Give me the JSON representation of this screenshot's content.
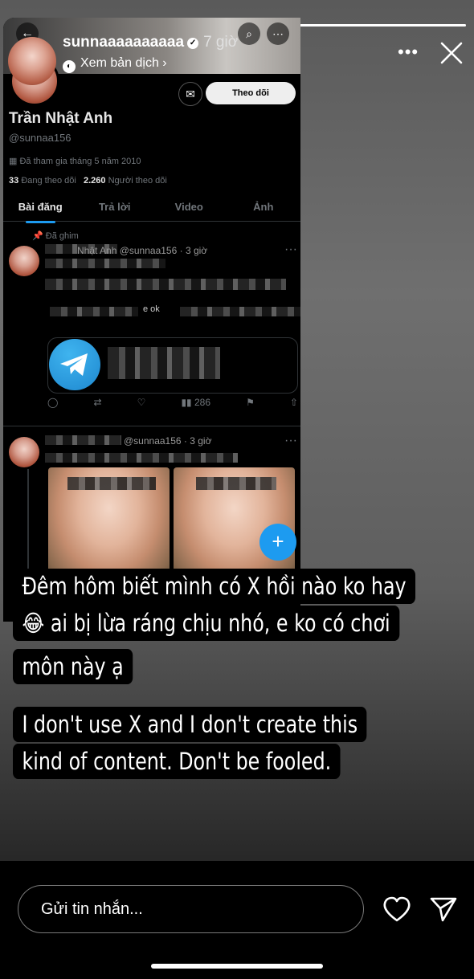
{
  "story": {
    "progress": 1.0,
    "username": "sunnaaaaaaaaaa",
    "time": "7 giờ",
    "translate_label": "Xem bản dịch",
    "more_label": "•••"
  },
  "tweet": {
    "name": "Trần Nhật Anh",
    "handle": "@sunnaa156",
    "joined": "Đã tham gia tháng 5 năm 2010",
    "following_count": "33",
    "following_label": "Đang theo dõi",
    "followers_count": "2.260",
    "followers_label": "Người theo dõi",
    "follow_button": "Theo dõi",
    "tabs": [
      "Bài đăng",
      "Trả lời",
      "Video",
      "Ảnh"
    ],
    "pinned_label": "Đã ghim",
    "post1_head": "Nhật Anh @sunnaa156 · 3 giờ",
    "post1_ok": "e ok",
    "post1_views": "286",
    "post2_head": "@sunnaa156 · 3 giờ"
  },
  "captions": {
    "line1": "Đêm hôm biết mình có X hồi nào ko hay",
    "line2": "😂 ai bị lừa ráng chịu nhó, e ko có chơi",
    "line3": "môn này ạ",
    "line4": "I don't use X and I don't create this",
    "line5": "kind of content. Don't be fooled."
  },
  "bottom": {
    "message_placeholder": "Gửi tin nhắn..."
  }
}
